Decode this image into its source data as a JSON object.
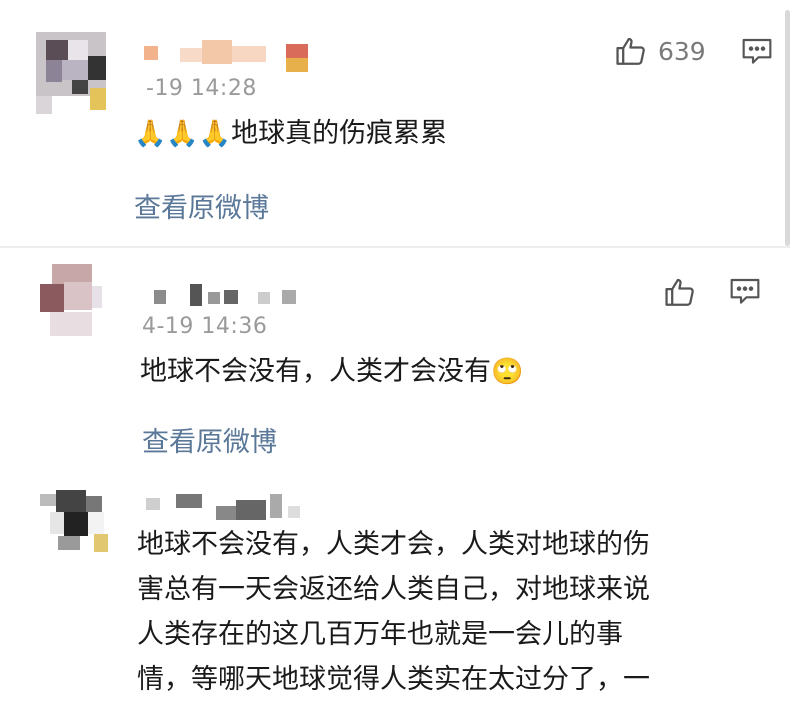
{
  "comments": [
    {
      "timestamp": "-19 14:28",
      "content_emoji": "🙏🙏🙏",
      "content_text": "地球真的伤痕累累",
      "view_original": "查看原微博",
      "like_count": "639"
    },
    {
      "timestamp": "4-19 14:36",
      "content_text": "地球不会没有，人类才会没有",
      "content_emoji": "🙄",
      "view_original": "查看原微博"
    },
    {
      "content_lines": [
        "地球不会没有，人类才会，人类对地球的伤",
        "害总有一天会返还给人类自己，对地球来说",
        "人类存在的这几百万年也就是一会儿的事",
        "情，等哪天地球觉得人类实在太过分了，一"
      ]
    }
  ],
  "icons": {
    "like": "thumbs-up-icon",
    "reply": "comment-bubble-icon"
  },
  "colors": {
    "link": "#5b7899",
    "meta": "#9a9a9a",
    "divider": "#ededed"
  }
}
